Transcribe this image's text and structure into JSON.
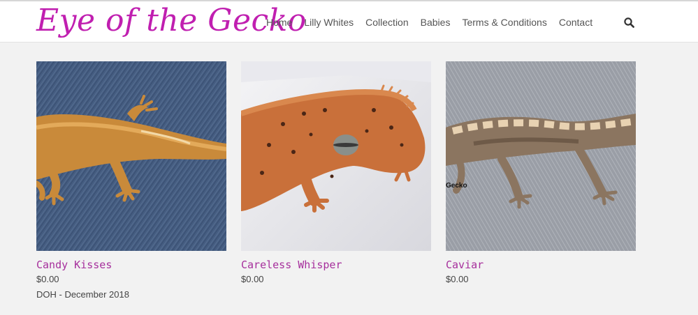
{
  "header": {
    "logo": "Eye of the Gecko",
    "nav": [
      {
        "label": "Home"
      },
      {
        "label": "Lilly Whites"
      },
      {
        "label": "Collection"
      },
      {
        "label": "Babies"
      },
      {
        "label": "Terms & Conditions"
      },
      {
        "label": "Contact"
      }
    ],
    "search_icon": "search-icon"
  },
  "products": [
    {
      "name": "Candy Kisses",
      "price": "$0.00",
      "note": "DOH - December 2018",
      "image": "orange gecko on denim"
    },
    {
      "name": "Careless Whisper",
      "price": "$0.00",
      "note": "",
      "image": "orange spotted gecko on white"
    },
    {
      "name": "Caviar",
      "price": "$0.00",
      "note": "",
      "image": "brown gecko on grey carpet",
      "watermark": "Gecko"
    }
  ],
  "colors": {
    "logo": "#c01fb0",
    "product_title": "#a62f9c",
    "nav_text": "#555555",
    "background": "#f2f2f2"
  }
}
